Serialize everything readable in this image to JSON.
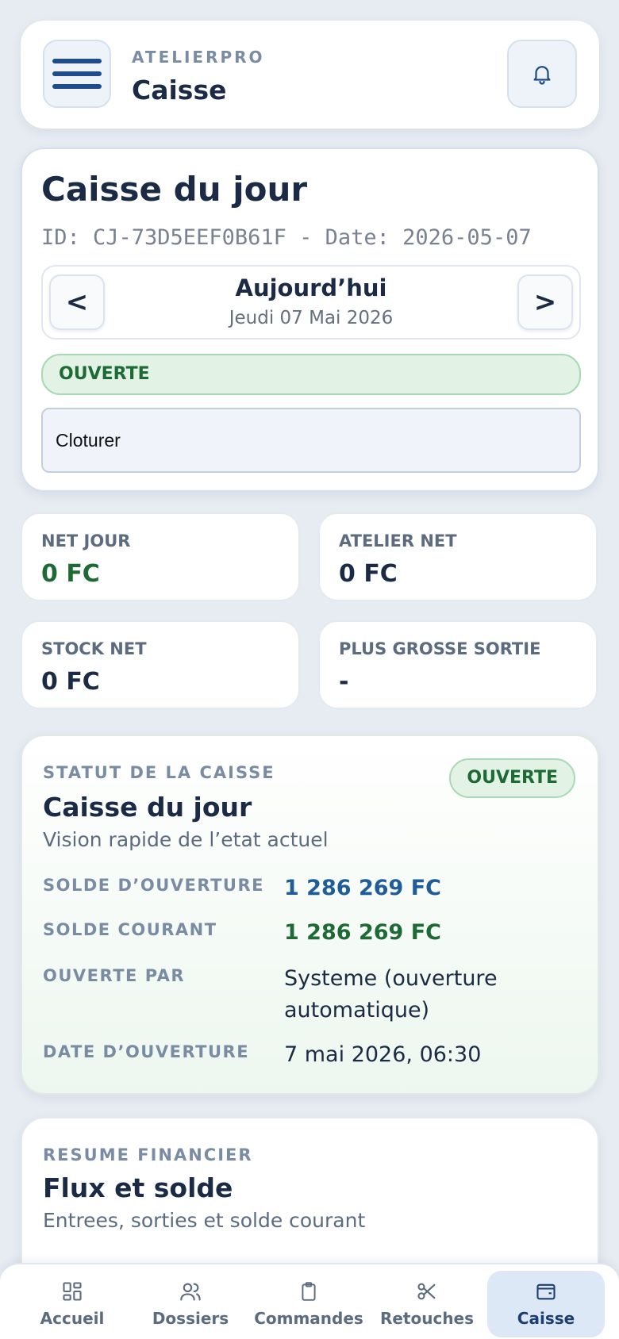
{
  "header": {
    "kicker": "ATELIERPRO",
    "title": "Caisse"
  },
  "day_card": {
    "title": "Caisse du jour",
    "id_line": "ID: CJ-73D5EEF0B61F - Date: 2026-05-07",
    "nav": {
      "prev": "<",
      "next": ">",
      "label": "Aujourd’hui",
      "sub": "Jeudi 07 Mai 2026"
    },
    "status": "OUVERTE",
    "action_select": "Cloturer"
  },
  "stats": [
    {
      "label": "NET JOUR",
      "value": "0 FC",
      "color": "#1e6a34"
    },
    {
      "label": "ATELIER NET",
      "value": "0 FC",
      "color": "#1b2b45"
    },
    {
      "label": "STOCK NET",
      "value": "0 FC",
      "color": "#1b2b45"
    },
    {
      "label": "PLUS GROSSE SORTIE",
      "value": "-",
      "color": "#1b2b45"
    }
  ],
  "status_section": {
    "kicker": "STATUT DE LA CAISSE",
    "title": "Caisse du jour",
    "subtitle": "Vision rapide de l’etat actuel",
    "badge": "OUVERTE",
    "rows": [
      {
        "label": "SOLDE D’OUVERTURE",
        "value": "1 286 269 FC",
        "color": "#1f5c99"
      },
      {
        "label": "SOLDE COURANT",
        "value": "1 286 269 FC",
        "color": "#1e6a34"
      },
      {
        "label": "OUVERTE PAR",
        "value": "Systeme (ouverture automatique)",
        "color": "#1b2b45"
      },
      {
        "label": "DATE D’OUVERTURE",
        "value": "7 mai 2026, 06:30",
        "color": "#1b2b45"
      }
    ]
  },
  "finance_section": {
    "kicker": "RESUME FINANCIER",
    "title": "Flux et solde",
    "subtitle": "Entrees, sorties et solde courant"
  },
  "bottom_nav": [
    {
      "label": "Accueil",
      "icon": "grid-icon"
    },
    {
      "label": "Dossiers",
      "icon": "users-icon"
    },
    {
      "label": "Commandes",
      "icon": "clipboard-icon"
    },
    {
      "label": "Retouches",
      "icon": "scissors-icon"
    },
    {
      "label": "Caisse",
      "icon": "wallet-icon",
      "active": true
    }
  ]
}
